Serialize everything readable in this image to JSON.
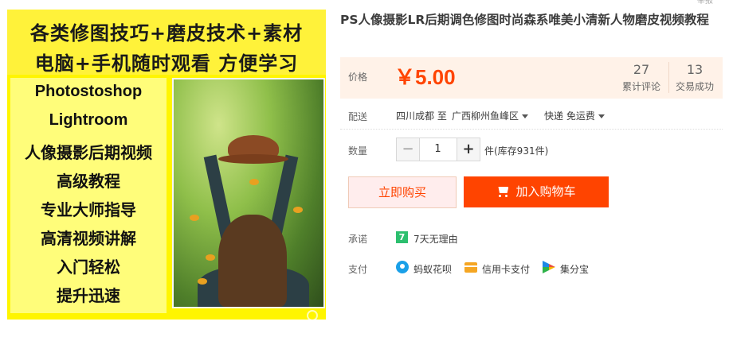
{
  "product_image": {
    "banner_line1": "各类修图技巧+磨皮技术+素材",
    "banner_line2": "电脑+手机随时观看 方便学习",
    "features": [
      "Photostoshop",
      "Lightroom",
      "人像摄影后期视频",
      "高级教程",
      "专业大师指导",
      "高清视频讲解",
      "入门轻松",
      "提升迅速"
    ],
    "background_color": "#fff500"
  },
  "header": {
    "title": "PS人像摄影LR后期调色修图时尚森系唯美小清新人物磨皮视频教程",
    "corner_mark": "举报"
  },
  "price_box": {
    "label": "价格",
    "value": "￥5.00",
    "reviews_count": "27",
    "reviews_label": "累计评论",
    "trades_count": "13",
    "trades_label": "交易成功",
    "accent_color": "#ff4400"
  },
  "shipping": {
    "label": "配送",
    "origin": "四川成都 至",
    "destination": "广西柳州鱼峰区",
    "method": "快递 免运费"
  },
  "quantity": {
    "label": "数量",
    "minus": "−",
    "value": "1",
    "plus": "+",
    "stock": "件(库存931件)"
  },
  "actions": {
    "buy_now": "立即购买",
    "add_to_cart": "加入购物车"
  },
  "promise": {
    "label": "承诺",
    "badge": "7",
    "text": "7天无理由"
  },
  "payment": {
    "label": "支付",
    "methods": [
      {
        "icon": "huabei-icon",
        "name": "蚂蚁花呗"
      },
      {
        "icon": "credit-card-icon",
        "name": "信用卡支付"
      },
      {
        "icon": "jifenbao-icon",
        "name": "集分宝"
      }
    ]
  }
}
